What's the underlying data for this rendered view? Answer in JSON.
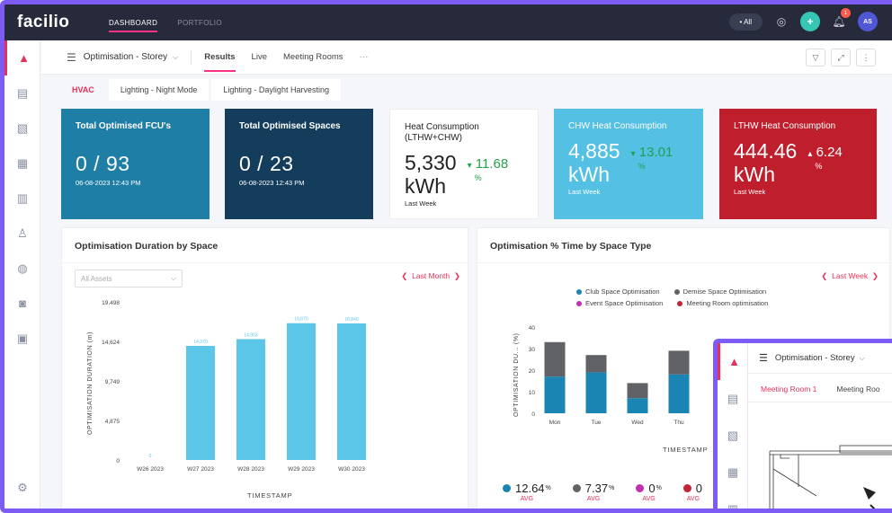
{
  "topbar": {
    "logo": "facilio",
    "tabs": [
      {
        "label": "DASHBOARD",
        "active": true
      },
      {
        "label": "PORTFOLIO",
        "active": false
      }
    ],
    "all_label": "• All",
    "notification_count": "1",
    "avatar_initials": "AS"
  },
  "subbar": {
    "dashboard_name": "Optimisation - Storey",
    "tabs": [
      {
        "label": "Results",
        "active": true
      },
      {
        "label": "Live"
      },
      {
        "label": "Meeting Rooms"
      }
    ],
    "more": "···"
  },
  "section_tabs": [
    {
      "label": "HVAC",
      "active": true
    },
    {
      "label": "Lighting - Night Mode"
    },
    {
      "label": "Lighting - Daylight Harvesting"
    }
  ],
  "cards": {
    "fcu": {
      "title": "Total Optimised FCU's",
      "value": "0 / 93",
      "date": "06-08-2023 12:43 PM"
    },
    "spaces": {
      "title": "Total Optimised Spaces",
      "value": "0 / 23",
      "date": "06-08-2023 12:43 PM"
    },
    "heat": {
      "title": "Heat Consumption (LTHW+CHW)",
      "value": "5,330",
      "unit": "kWh",
      "delta_arrow": "▾",
      "delta": "11.68",
      "delta_unit": "%",
      "period": "Last Week"
    },
    "chw": {
      "title": "CHW Heat Consumption",
      "value": "4,885",
      "unit": "kWh",
      "delta_arrow": "▾",
      "delta": "13.01",
      "delta_unit": "%",
      "period": "Last Week"
    },
    "lthw": {
      "title": "LTHW Heat Consumption",
      "value": "444.46",
      "unit": "kWh",
      "delta_arrow": "▴",
      "delta": "6.24",
      "delta_unit": "%",
      "period": "Last Week"
    }
  },
  "panel1": {
    "title": "Optimisation Duration by Space",
    "assets_placeholder": "All Assets",
    "period": "Last Month"
  },
  "panel2": {
    "title": "Optimisation % Time by Space Type",
    "period": "Last Week"
  },
  "chart_data": [
    {
      "type": "bar",
      "title": "Optimisation Duration by Space",
      "categories": [
        "W26 2023",
        "W27 2023",
        "W28 2023",
        "W29 2023",
        "W30 2023"
      ],
      "values": [
        0,
        14070,
        14903,
        16870,
        16840
      ],
      "data_labels": [
        "0",
        "14,070",
        "14,903",
        "16,870",
        "16,840"
      ],
      "yticks": [
        "19,498",
        "14,624",
        "9,749",
        "4,875",
        "0"
      ],
      "ylim": [
        0,
        19498
      ],
      "xlabel": "TIMESTAMP",
      "ylabel": "OPTIMISATION DURATION (m)",
      "color": "#5cc6e8"
    },
    {
      "type": "bar",
      "stacked": true,
      "title": "Optimisation % Time by Space Type",
      "categories": [
        "Mon",
        "Tue",
        "Wed",
        "Thu"
      ],
      "series": [
        {
          "name": "Club Space Optimisation",
          "color": "#1a85b3",
          "values": [
            17,
            19,
            7,
            18
          ]
        },
        {
          "name": "Demise Space Optimisation",
          "color": "#606266",
          "values": [
            16,
            8,
            7,
            11
          ]
        },
        {
          "name": "Event Space Optimisation",
          "color": "#c12fb3",
          "values": [
            0,
            0,
            0,
            0
          ]
        },
        {
          "name": "Meeting Room optimisation",
          "color": "#c22636",
          "values": [
            0,
            0,
            0,
            0
          ]
        }
      ],
      "yticks": [
        "40",
        "30",
        "20",
        "10",
        "0"
      ],
      "ylim": [
        0,
        40
      ],
      "xlabel": "TIMESTAMP",
      "ylabel": "OPTIMISATION DU... (%)",
      "avg_label": "AVG",
      "averages": [
        {
          "value": "12.64",
          "unit": "%",
          "color": "#1a85b3"
        },
        {
          "value": "7.37",
          "unit": "%",
          "color": "#606266"
        },
        {
          "value": "0",
          "unit": "%",
          "color": "#c12fb3"
        },
        {
          "value": "0",
          "unit": "",
          "color": "#c22636"
        }
      ]
    }
  ],
  "overlay": {
    "dashboard_name": "Optimisation - Storey",
    "tabs": [
      {
        "label": "Meeting Room 1",
        "active": true
      },
      {
        "label": "Meeting Roo"
      }
    ]
  }
}
